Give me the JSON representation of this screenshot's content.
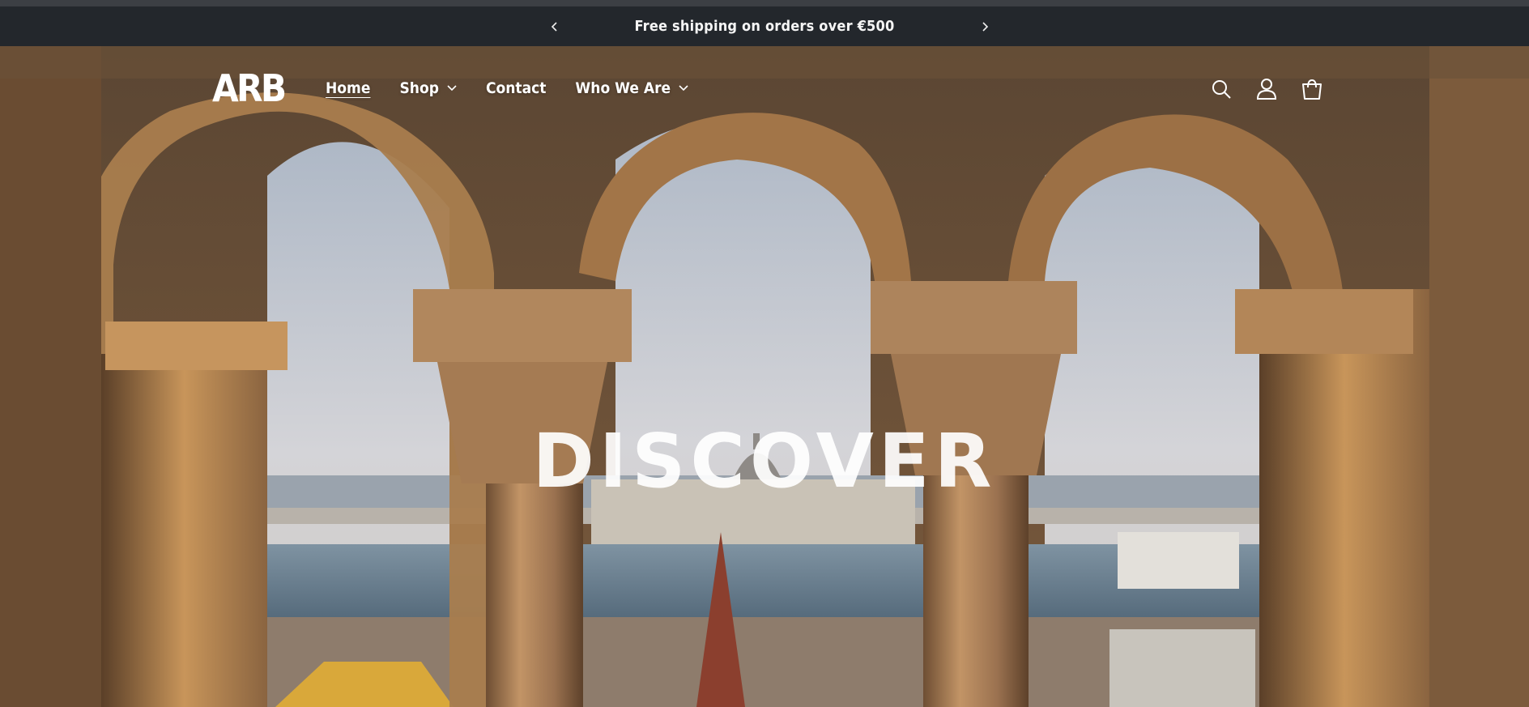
{
  "announcement": {
    "text": "Free shipping on orders over €500",
    "prev_label": "‹",
    "next_label": "›"
  },
  "header": {
    "logo_text": "ARB",
    "nav": [
      {
        "label": "Home",
        "active": true,
        "has_dropdown": false
      },
      {
        "label": "Shop",
        "active": false,
        "has_dropdown": true
      },
      {
        "label": "Contact",
        "active": false,
        "has_dropdown": false
      },
      {
        "label": "Who We Are",
        "active": false,
        "has_dropdown": true
      }
    ],
    "icons": [
      "search-icon",
      "account-icon",
      "cart-icon"
    ]
  },
  "hero": {
    "title": "DISCOVER"
  },
  "colors": {
    "announcement_bg": "#23272c",
    "stone": "#b98a52",
    "sky": "#c6cdd6",
    "water": "#5e7586"
  }
}
